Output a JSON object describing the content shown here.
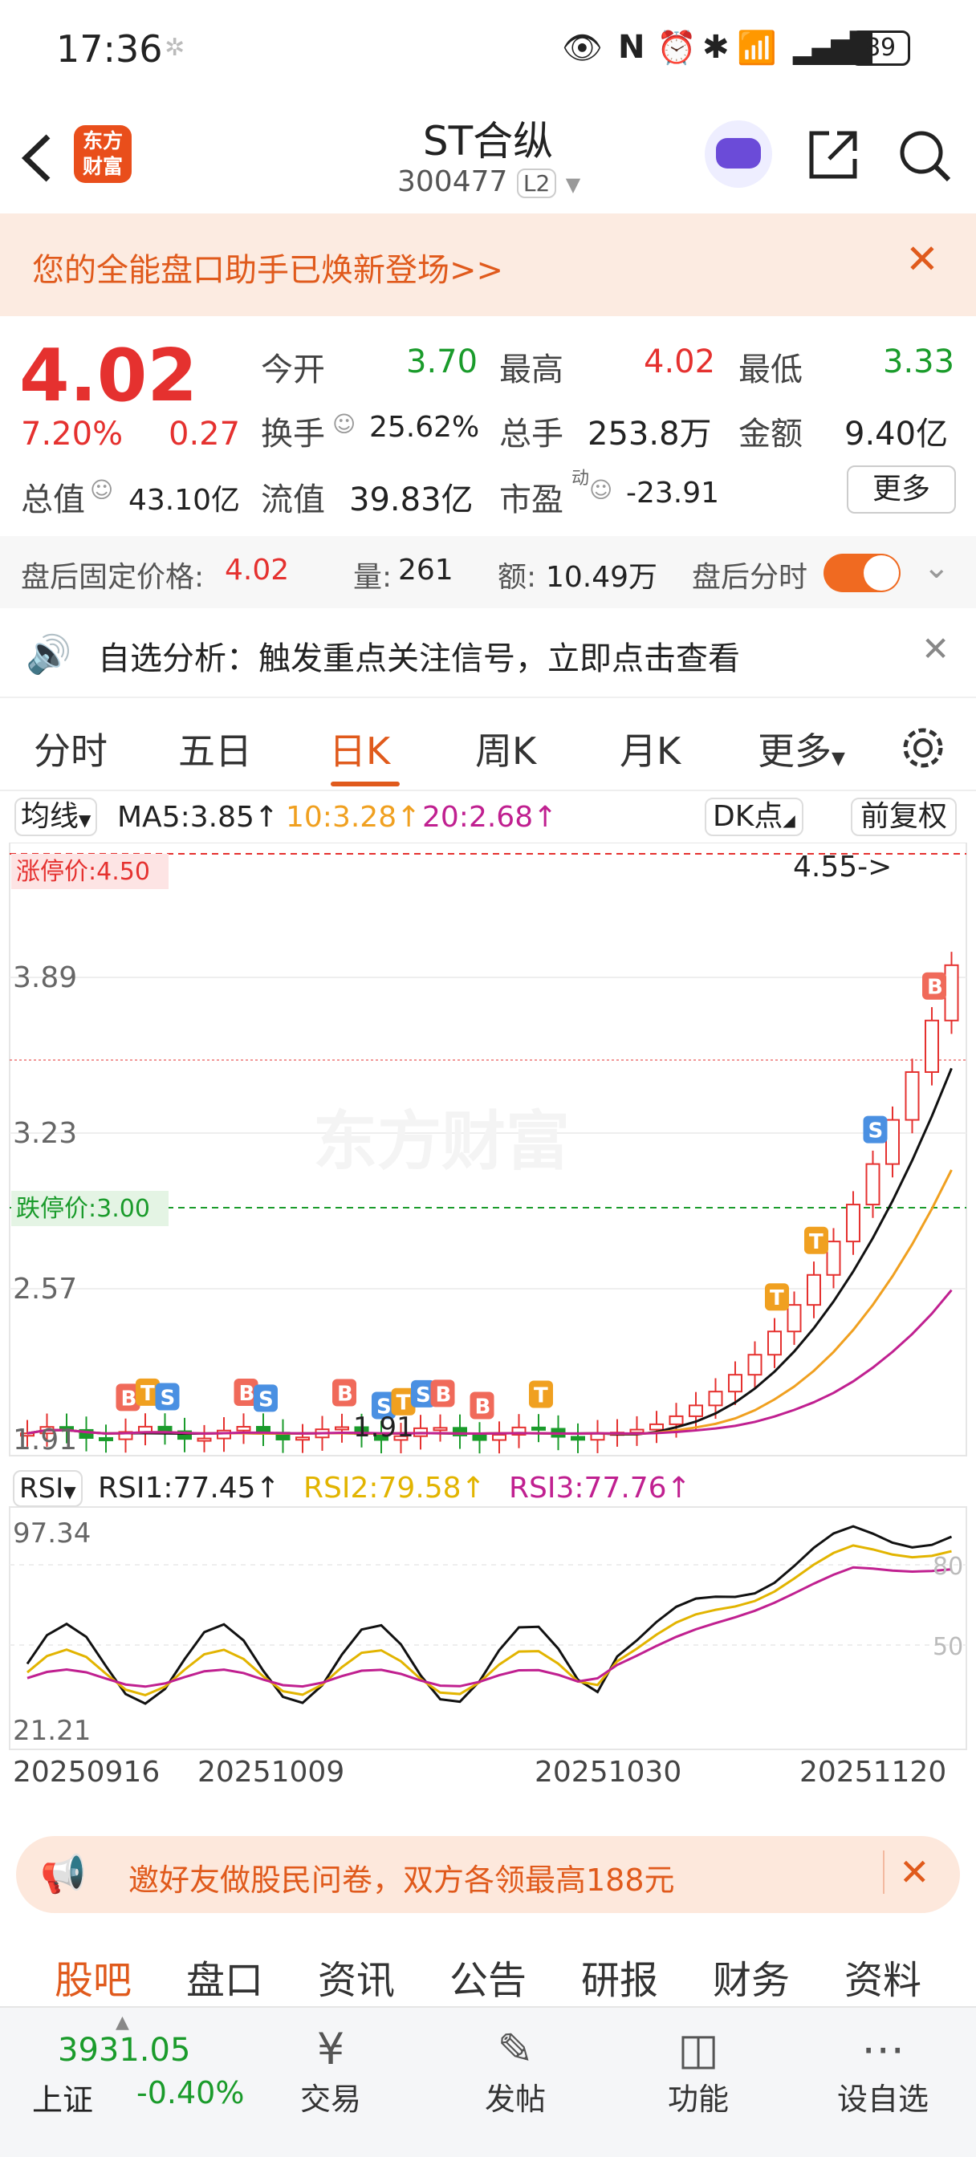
{
  "status": {
    "time": "17:36",
    "battery": "89"
  },
  "header": {
    "title": "ST合纵",
    "code": "300477",
    "level": "L2",
    "logo": "东方财富",
    "back_icon": "back-arrow-icon",
    "share_icon": "share-icon",
    "search_icon": "search-icon"
  },
  "banner": {
    "text": "您的全能盘口助手已焕新登场>>"
  },
  "quote": {
    "price": "4.02",
    "change_pct": "7.20%",
    "change": "0.27",
    "open_label": "今开",
    "open": "3.70",
    "high_label": "最高",
    "high": "4.02",
    "low_label": "最低",
    "low": "3.33",
    "turnover_label": "换手",
    "turnover": "25.62%",
    "volume_label": "总手",
    "volume": "253.8万",
    "amount_label": "金额",
    "amount": "9.40亿",
    "mktcap_label": "总值",
    "mktcap": "43.10亿",
    "float_label": "流值",
    "float": "39.83亿",
    "pe_label": "市盈",
    "pe_sup": "动",
    "pe": "-23.91",
    "more": "更多"
  },
  "after": {
    "fixed_label": "盘后固定价格:",
    "fixed": "4.02",
    "vol_label": "量:",
    "vol": "261",
    "amt_label": "额:",
    "amt": "10.49万",
    "intraday_label": "盘后分时",
    "toggle_on": true
  },
  "alert": {
    "text": "自选分析：触发重点关注信号，立即点击查看"
  },
  "tabs": [
    "分时",
    "五日",
    "日K",
    "周K",
    "月K",
    "更多"
  ],
  "active_tab": "日K",
  "kline": {
    "ma_select": "均线",
    "ma5": "MA5:3.85↑",
    "ma10": "10:3.28↑",
    "ma20": "20:2.68↑",
    "dk": "DK点",
    "adjust": "前复权",
    "limit_up": "涨停价:4.50",
    "limit_down": "跌停价:3.00",
    "high_marker": "4.55->",
    "low_marker": "1.91",
    "y_labels": [
      "3.89",
      "3.23",
      "2.57",
      "1.91"
    ],
    "watermark": "东方财富",
    "colors": {
      "ma5": "#111111",
      "ma10": "#f0a020",
      "ma20": "#c02090",
      "up": "#e5312f",
      "down": "#1a9b2b"
    }
  },
  "rsi": {
    "select": "RSI",
    "rsi1": "RSI1:77.45↑",
    "rsi2": "RSI2:79.58↑",
    "rsi3": "RSI3:77.76↑",
    "top": "97.34",
    "bottom": "21.21",
    "l80": "80",
    "l50": "50"
  },
  "dates": [
    "20250916",
    "20251009",
    "20251030",
    "20251120"
  ],
  "promo": {
    "text": "邀好友做股民问卷，双方各领最高188元"
  },
  "bottom_tabs": [
    "股吧",
    "盘口",
    "资讯",
    "公告",
    "研报",
    "财务",
    "资料"
  ],
  "active_bottom": "股吧",
  "index": {
    "value": "3931.05",
    "name": "上证",
    "change": "-0.40%"
  },
  "dock": [
    "交易",
    "发帖",
    "功能",
    "设自选"
  ]
}
